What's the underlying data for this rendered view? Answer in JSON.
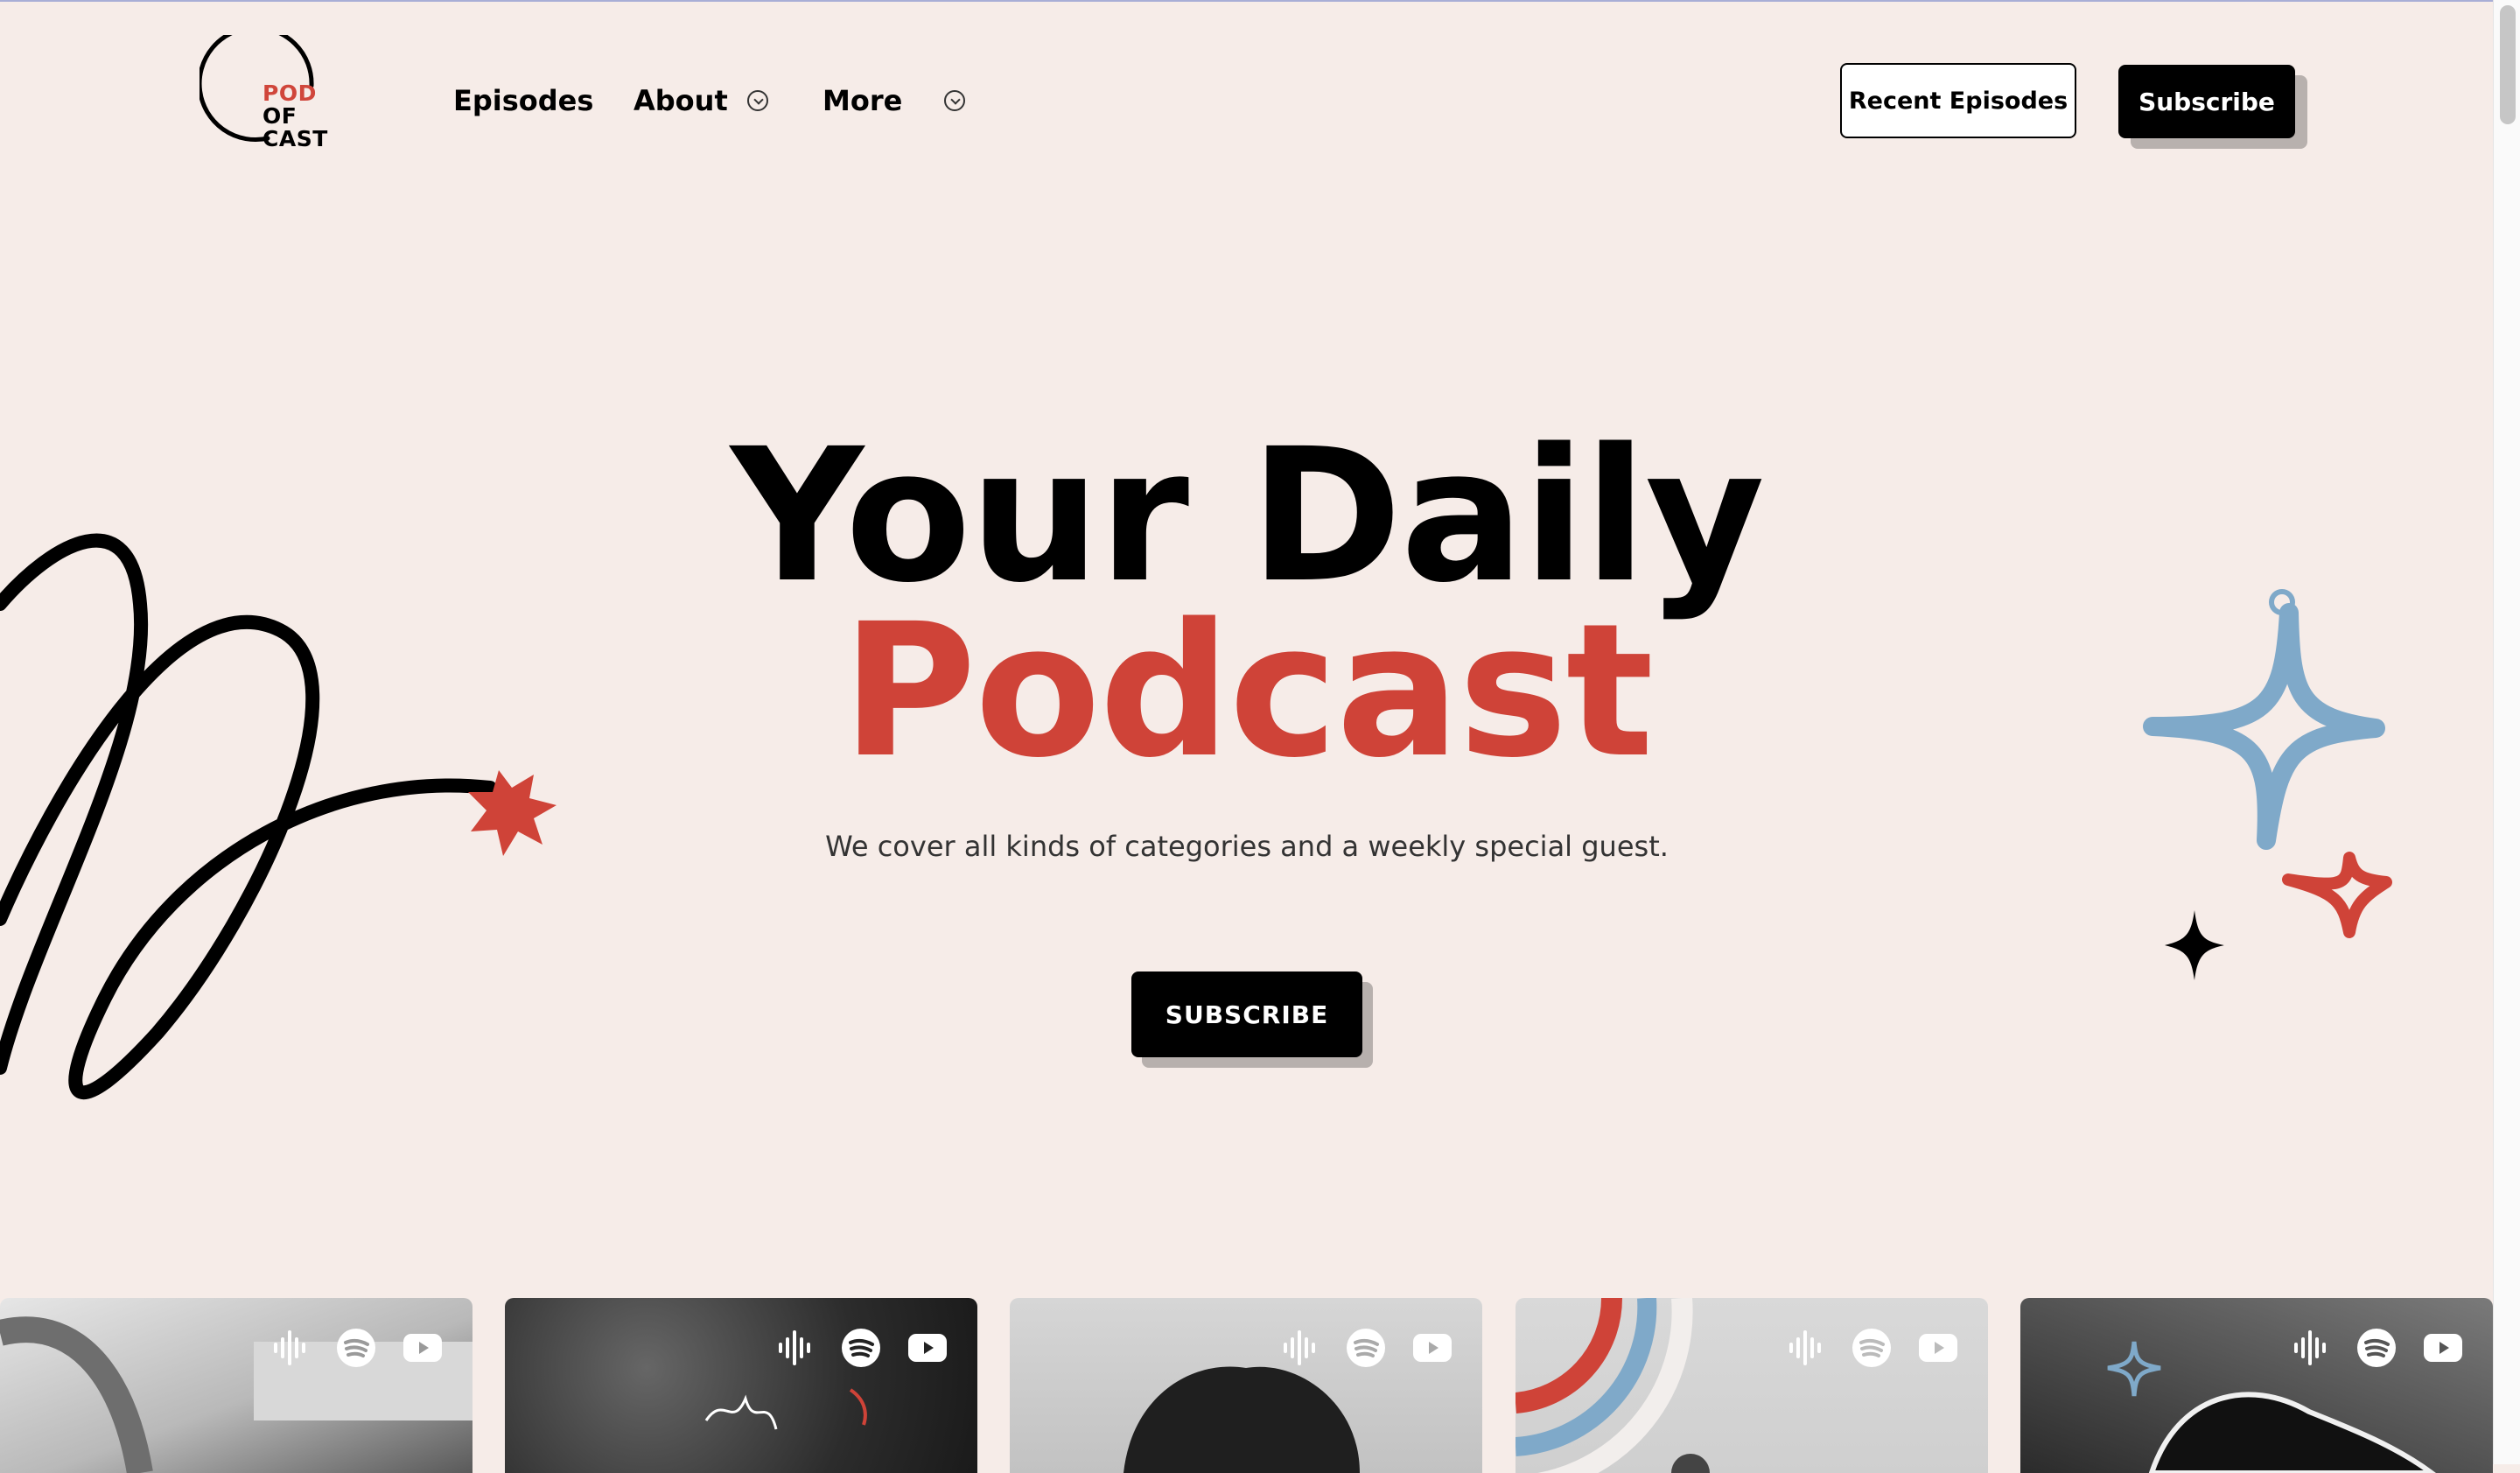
{
  "brand": {
    "logo_lines": [
      "POD",
      "OF",
      "CAST"
    ],
    "accent_color": "#cf4338",
    "secondary_color": "#7fa9c9",
    "background_color": "#f6ece8"
  },
  "nav": {
    "episodes": "Episodes",
    "about": "About",
    "more": "More"
  },
  "header_buttons": {
    "recent_episodes": "Recent Episodes",
    "subscribe": "Subscribe"
  },
  "hero": {
    "title_line1": "Your Daily",
    "title_line2": "Podcast",
    "subtitle": "We cover all kinds of categories and a weekly special guest.",
    "cta": "SUBSCRIBE"
  },
  "episode_cards": [
    {
      "icons": [
        "apple-podcasts-icon",
        "spotify-icon",
        "youtube-icon"
      ]
    },
    {
      "icons": [
        "apple-podcasts-icon",
        "spotify-icon",
        "youtube-icon"
      ]
    },
    {
      "icons": [
        "apple-podcasts-icon",
        "spotify-icon",
        "youtube-icon"
      ]
    },
    {
      "icons": [
        "apple-podcasts-icon",
        "spotify-icon",
        "youtube-icon"
      ]
    },
    {
      "icons": [
        "apple-podcasts-icon",
        "spotify-icon",
        "youtube-icon"
      ]
    }
  ]
}
